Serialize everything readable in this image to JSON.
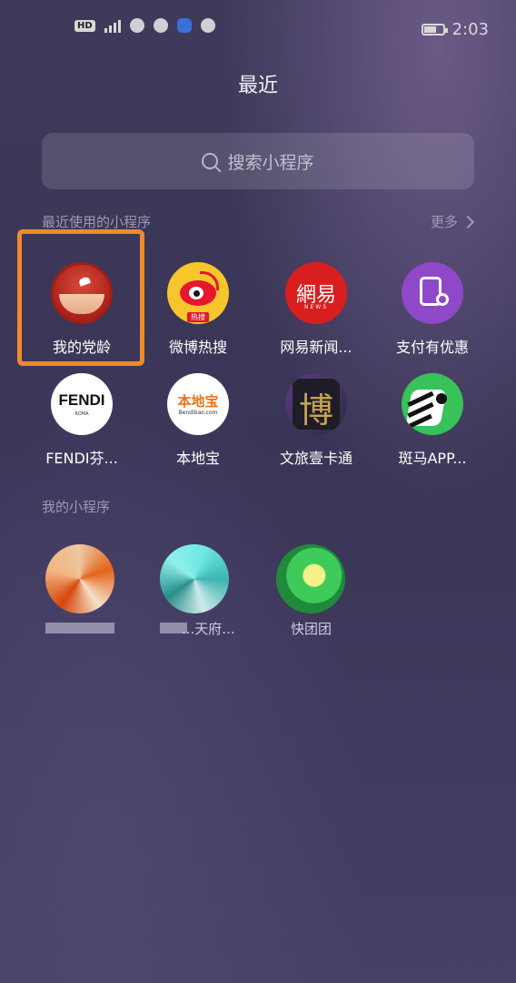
{
  "status": {
    "network_badge": "HD",
    "time": "2:03"
  },
  "header": {
    "title": "最近"
  },
  "search": {
    "placeholder": "搜索小程序"
  },
  "recent": {
    "label": "最近使用的小程序",
    "more": "更多",
    "apps": [
      {
        "name": "我的党龄",
        "icon": "party-age-icon",
        "selected": true
      },
      {
        "name": "微博热搜",
        "icon": "weibo-icon"
      },
      {
        "name": "网易新闻...",
        "icon": "netease-news-icon"
      },
      {
        "name": "支付有优惠",
        "icon": "alipay-discount-icon"
      },
      {
        "name": "FENDI芬...",
        "icon": "fendi-icon"
      },
      {
        "name": "本地宝",
        "icon": "bendibao-icon"
      },
      {
        "name": "文旅壹卡通",
        "icon": "culture-travel-card-icon"
      },
      {
        "name": "斑马APP...",
        "icon": "zebra-app-icon"
      }
    ],
    "icon_text": {
      "weibo_badge": "热搜",
      "netease_main": "網易",
      "netease_sub": "NEWS",
      "fendi_main": "FENDI",
      "fendi_sub": "ROMA",
      "bendibao_main": "本地宝",
      "bendibao_sub": "Bendibao.com",
      "wenlv_char": "博"
    }
  },
  "mine": {
    "label": "我的小程序",
    "apps": [
      {
        "name": "",
        "icon": "pixelated-app-icon"
      },
      {
        "name": "...天府...",
        "icon": "pixelated-app-icon"
      },
      {
        "name": "快团团",
        "icon": "pixelated-app-icon"
      }
    ]
  },
  "colors": {
    "highlight": "#f08a2a",
    "background": "#3d3858"
  }
}
